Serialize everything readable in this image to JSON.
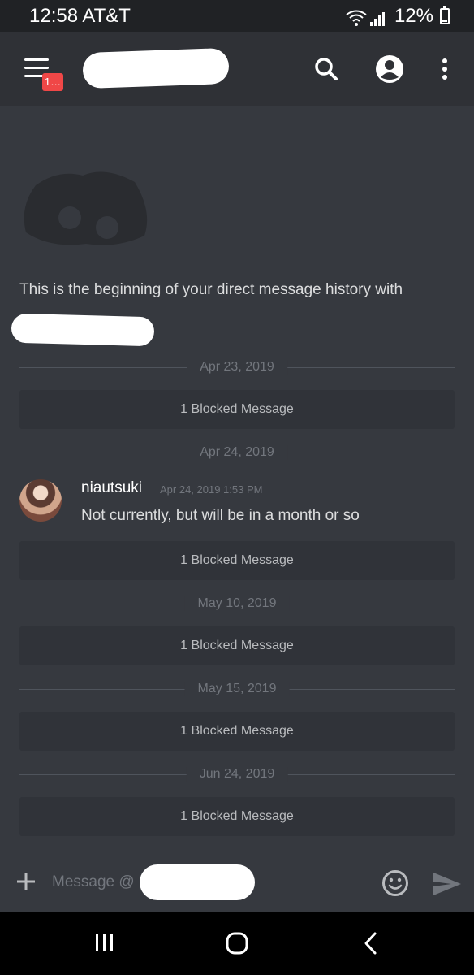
{
  "status_bar": {
    "time_carrier": "12:58 AT&T",
    "battery_percent": "12%"
  },
  "header": {
    "badge": "1…",
    "icons": [
      "menu-icon",
      "search-icon",
      "account-icon",
      "more-vert-icon"
    ]
  },
  "intro": {
    "text": "This is the beginning of your direct message history with"
  },
  "timeline": {
    "date_1": "Apr 23, 2019",
    "blocked_1": "1 Blocked Message",
    "date_2": "Apr 24, 2019",
    "blocked_2": "1 Blocked Message",
    "date_3": "May 10, 2019",
    "blocked_3": "1 Blocked Message",
    "date_4": "May 15, 2019",
    "blocked_4": "1 Blocked Message",
    "date_5": "Jun 24, 2019",
    "blocked_5": "1 Blocked Message"
  },
  "message": {
    "author": "niautsuki",
    "timestamp": "Apr 24, 2019 1:53 PM",
    "text": "Not currently, but will be in a month or so"
  },
  "composer": {
    "placeholder": "Message @"
  },
  "colors": {
    "background": "#36393f",
    "header": "#2f3136",
    "badge": "#f04747",
    "blocked_bg": "#303339"
  }
}
